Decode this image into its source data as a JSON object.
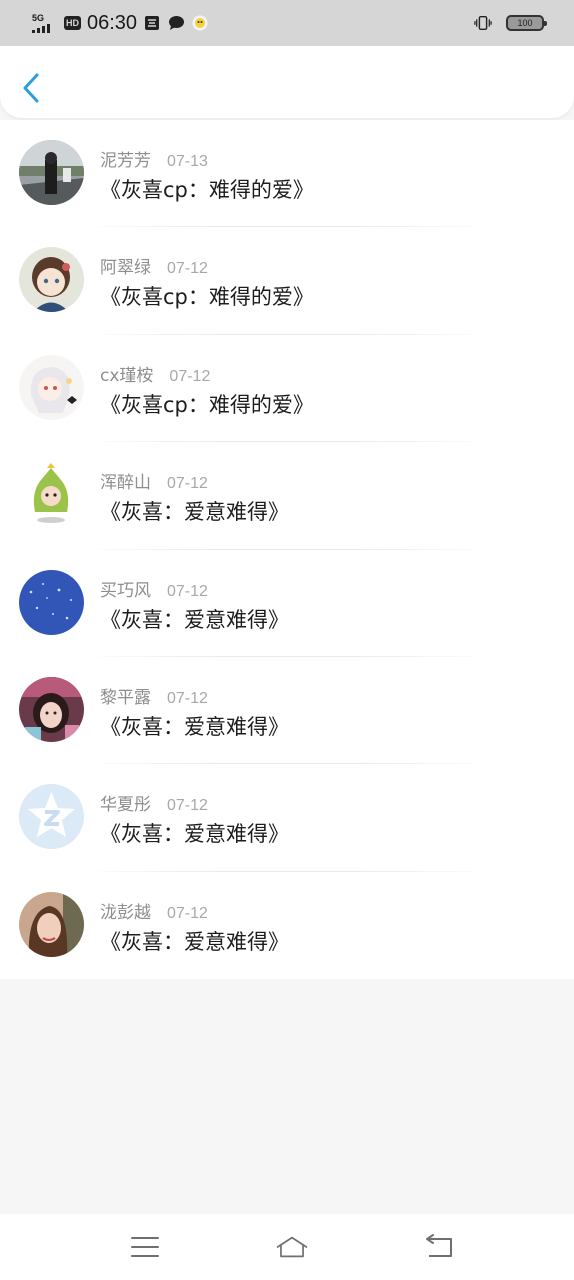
{
  "status_bar": {
    "network": "5G",
    "hd": "HD",
    "time": "06:30",
    "battery": "100",
    "icons": [
      "sim-card-icon",
      "message-bubble-icon",
      "app-notification-icon",
      "vibrate-icon",
      "battery-icon"
    ]
  },
  "header": {
    "back_icon": "chevron-left-icon",
    "accent": "#2a9fd8"
  },
  "items": [
    {
      "name": "泥芳芳",
      "date": "07-13",
      "title": "《灰喜cp：难得的爱》"
    },
    {
      "name": "阿翠绿",
      "date": "07-12",
      "title": "《灰喜cp：难得的爱》"
    },
    {
      "name": "cx瑾桉",
      "date": "07-12",
      "title": "《灰喜cp：难得的爱》"
    },
    {
      "name": "浑醉山",
      "date": "07-12",
      "title": "《灰喜：爱意难得》"
    },
    {
      "name": "买巧风",
      "date": "07-12",
      "title": "《灰喜：爱意难得》"
    },
    {
      "name": "黎平露",
      "date": "07-12",
      "title": "《灰喜：爱意难得》"
    },
    {
      "name": "华夏彤",
      "date": "07-12",
      "title": "《灰喜：爱意难得》"
    },
    {
      "name": "泷彭越",
      "date": "07-12",
      "title": "《灰喜：爱意难得》"
    }
  ],
  "navbar": {
    "icons": [
      "menu-icon",
      "home-icon",
      "back-icon"
    ]
  }
}
